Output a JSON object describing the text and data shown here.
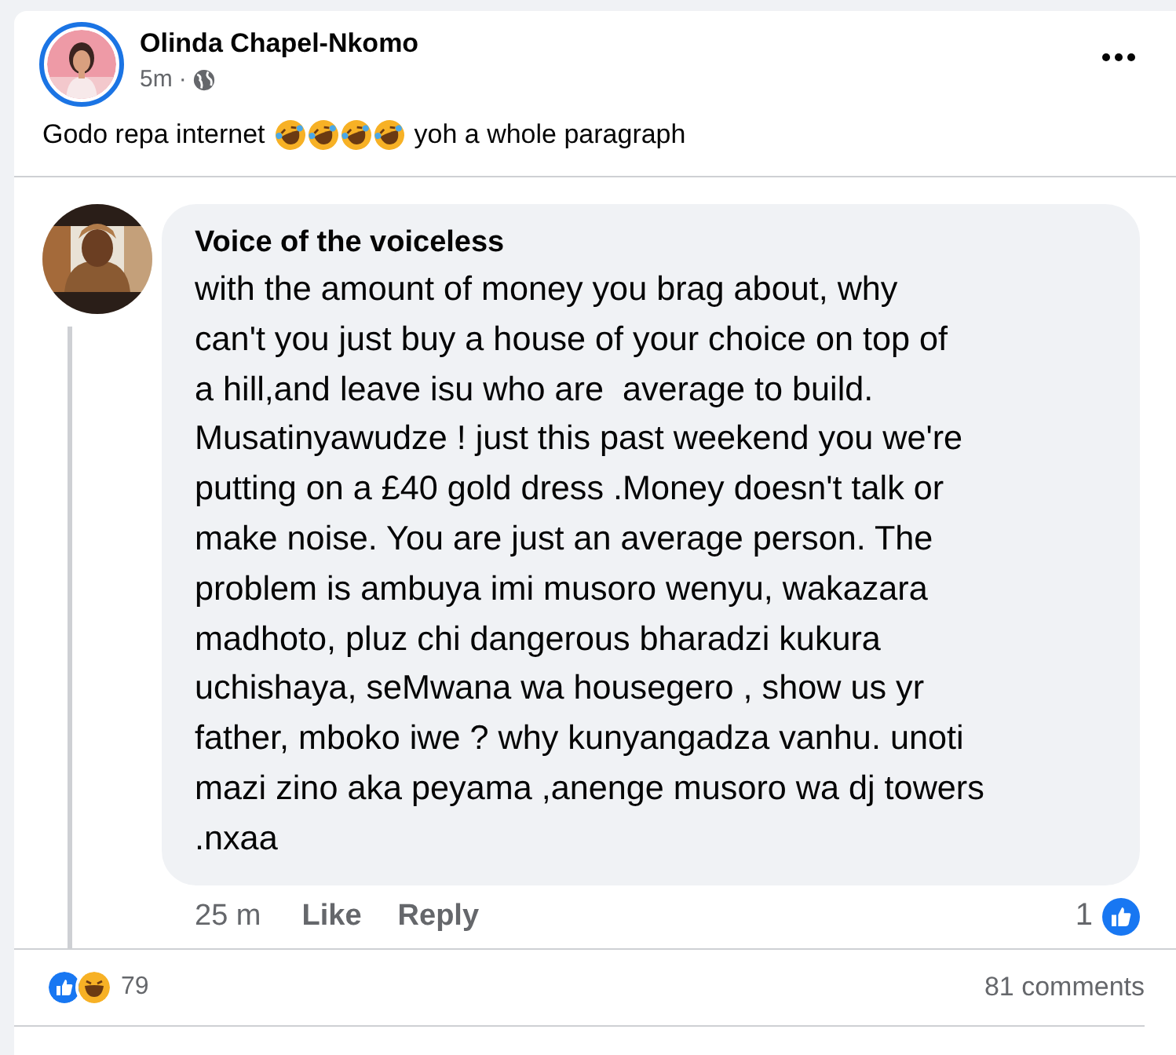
{
  "post": {
    "author": "Olinda Chapel-Nkomo",
    "time": "5m",
    "separator": "·",
    "text_before": "Godo repa internet",
    "text_after": "yoh a whole paragraph",
    "emojis": [
      {
        "kind": "laughing"
      },
      {
        "kind": "laughing"
      },
      {
        "kind": "laughing"
      },
      {
        "kind": "laughing"
      }
    ]
  },
  "comment": {
    "author": "Voice of the voiceless",
    "text": "with the amount of money you brag about, why\ncan't you just buy a house of your choice on top of\na hill,and leave isu who are  average to build.\nMusatinyawudze ! just this past weekend you we're\nputting on a £40 gold dress .Money doesn't talk or\nmake noise. You are just an average person. The\nproblem is ambuya imi musoro wenyu, wakazara\nmadhoto, pluz chi dangerous bharadzi kukura\nuchishaya, seMwana wa housegero , show us yr\nfather, mboko iwe ? why kunyangadza vanhu. unoti\nmazi zino aka peyama ,anenge musoro wa dj towers\n.nxaa",
    "time": "25 m",
    "actions": [
      "Like",
      "Reply"
    ],
    "reaction_count": "1"
  },
  "summary": {
    "reaction_count": "79",
    "comments": "81 comments"
  }
}
